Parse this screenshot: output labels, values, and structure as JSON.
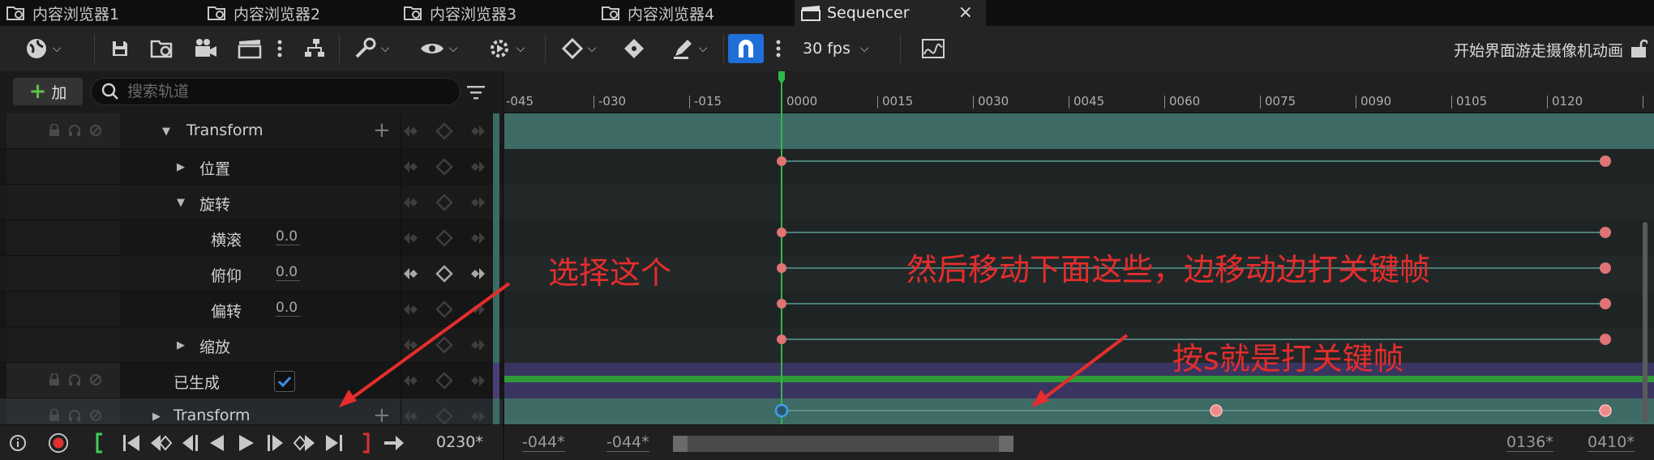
{
  "tabs": [
    {
      "label": "内容浏览器1",
      "icon": "folder-search-icon"
    },
    {
      "label": "内容浏览器2",
      "icon": "folder-search-icon"
    },
    {
      "label": "内容浏览器3",
      "icon": "folder-search-icon"
    },
    {
      "label": "内容浏览器4",
      "icon": "folder-search-icon"
    },
    {
      "label": "Sequencer",
      "icon": "clapperboard-icon",
      "active": true,
      "close": "×"
    }
  ],
  "toolbar": {
    "fps": "30 fps",
    "sequence_name": "开始界面游走摄像机动画",
    "snap_color": "#1e6fd8"
  },
  "outliner": {
    "add_label": "加",
    "search_placeholder": "搜索轨道",
    "rows": [
      {
        "label": "Transform"
      },
      {
        "label": "位置"
      },
      {
        "label": "旋转"
      },
      {
        "label": "横滚",
        "value": "0.0"
      },
      {
        "label": "俯仰",
        "value": "0.0"
      },
      {
        "label": "偏转",
        "value": "0.0"
      },
      {
        "label": "缩放"
      },
      {
        "label": "已生成"
      },
      {
        "label": "Transform"
      }
    ]
  },
  "ruler": {
    "ticks": [
      "-045",
      "-030",
      "-015",
      "0000",
      "0015",
      "0030",
      "0045",
      "0060",
      "0075",
      "0090",
      "0105",
      "0120"
    ]
  },
  "annotations": {
    "select": "选择这个",
    "move": "然后移动下面这些，边移动边打关键帧",
    "key": "按s就是打关键帧",
    "color": "#e52d2d"
  },
  "bottom": {
    "current_frame": "0230*",
    "view_start": "-044*",
    "view_start2": "-044*",
    "range_end": "0136*",
    "view_end": "0410*"
  },
  "colors": {
    "track_lane": "#3f6b66",
    "keyframe": "#e07373",
    "playhead": "#2fb84a"
  }
}
